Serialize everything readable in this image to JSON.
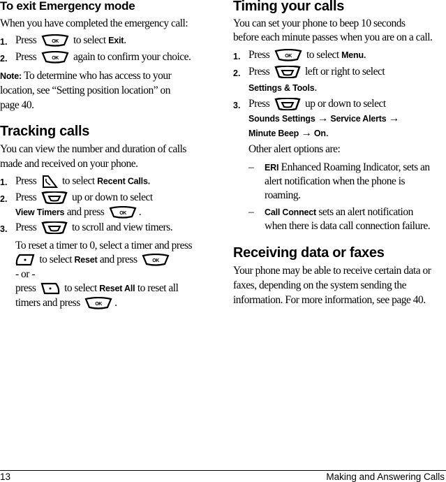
{
  "left": {
    "emergency": {
      "title": "To exit Emergency mode",
      "intro": "When you have completed the emergency call:",
      "steps": [
        {
          "num": "1.",
          "pre": "Press",
          "key": "ok-key-icon",
          "post": "to select",
          "bold": "Exit",
          "end": "."
        },
        {
          "num": "2.",
          "pre": "Press",
          "key": "ok-key-icon",
          "post": "again to confirm your choice."
        }
      ],
      "note_label": "Note:",
      "note_lines": [
        "To determine who has access to your",
        "location, see “Setting position location” on",
        "page 40."
      ]
    },
    "tracking": {
      "title": "Tracking calls",
      "intro_lines": [
        "You can view the number and duration of calls",
        "made and received on your phone."
      ],
      "steps": [
        {
          "num": "1.",
          "pre": "Press",
          "key": "recent-calls-key-icon",
          "post": "to select",
          "bold": "Recent Calls."
        },
        {
          "num": "2.",
          "pre": "Press",
          "key": "nav-key-icon",
          "post": "up or down to select",
          "bold2": "View Timers",
          "post2": "and press",
          "key2": "ok-key-icon",
          "end": "."
        },
        {
          "num": "3.",
          "pre": "Press",
          "key": "nav-key-icon",
          "post": "to scroll and view timers."
        }
      ],
      "reset_line1": "To reset a timer to 0, select a timer and press",
      "reset_line2_post": "to select",
      "reset_line2_bold": "Reset",
      "reset_line2_end": "and press",
      "or": "- or -",
      "reset_line4_pre": "press",
      "reset_line4_post": "to select",
      "reset_line4_bold": "Reset All",
      "reset_line4_end": "to reset all",
      "reset_line5": "timers and press",
      "reset_line5_end": "."
    }
  },
  "right": {
    "timing": {
      "title": "Timing your calls",
      "intro_lines": [
        "You can set your phone to beep 10 seconds",
        "before each minute passes when you are on a call."
      ],
      "steps": [
        {
          "num": "1.",
          "pre": "Press",
          "key": "ok-key-icon",
          "post": "to select",
          "bold": "Menu",
          "end": "."
        },
        {
          "num": "2.",
          "pre": "Press",
          "key": "nav-key-icon",
          "post": "left or right to select",
          "bold2": "Settings & Tools",
          "end": "."
        },
        {
          "num": "3.",
          "pre": "Press",
          "key": "nav-key-icon",
          "post": "up or down to select",
          "path1": "Sounds Settings",
          "path2": "Service Alerts",
          "path3": "Minute Beep",
          "path4": "On",
          "arrow": "→",
          "end": "."
        }
      ],
      "other_intro": "Other alert options are:",
      "bullets": [
        {
          "dash": "–",
          "bold": "ERI",
          "lines": [
            "Enhanced Roaming Indicator, sets an",
            "alert notification when the phone is",
            "roaming."
          ]
        },
        {
          "dash": "–",
          "bold": "Call Connect",
          "lines": [
            "sets an alert notification",
            "when there is data call connection failure."
          ]
        }
      ]
    },
    "receiving": {
      "title": "Receiving data or faxes",
      "lines": [
        "Your phone may be able to receive certain data or",
        "faxes, depending on the system sending the",
        "information. For more information, see page 40."
      ]
    }
  },
  "footer": {
    "page_number": "13",
    "chapter": "Making and Answering Calls"
  }
}
